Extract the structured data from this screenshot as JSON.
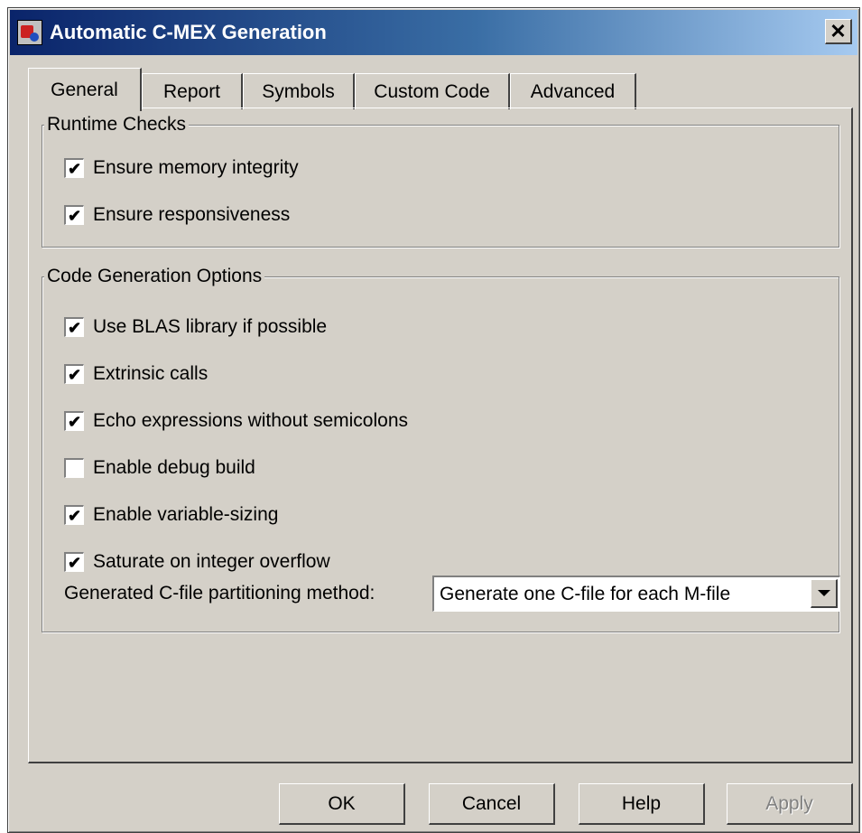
{
  "window": {
    "title": "Automatic C-MEX Generation",
    "close_label": "✕"
  },
  "tabs": [
    {
      "label": "General",
      "active": true
    },
    {
      "label": "Report",
      "active": false
    },
    {
      "label": "Symbols",
      "active": false
    },
    {
      "label": "Custom Code",
      "active": false
    },
    {
      "label": "Advanced",
      "active": false
    }
  ],
  "runtime_checks": {
    "title": "Runtime Checks",
    "options": [
      {
        "label": "Ensure memory integrity",
        "checked": true
      },
      {
        "label": "Ensure responsiveness",
        "checked": true
      }
    ]
  },
  "codegen": {
    "title": "Code Generation Options",
    "options": [
      {
        "label": "Use BLAS library if possible",
        "checked": true
      },
      {
        "label": "Extrinsic calls",
        "checked": true
      },
      {
        "label": "Echo expressions without semicolons",
        "checked": true
      },
      {
        "label": "Enable debug build",
        "checked": false
      },
      {
        "label": "Enable variable-sizing",
        "checked": true
      },
      {
        "label": "Saturate on integer overflow",
        "checked": true
      }
    ],
    "partition_label": "Generated C-file partitioning method:",
    "partition_value": "Generate one C-file for each M-file"
  },
  "buttons": {
    "ok": "OK",
    "cancel": "Cancel",
    "help": "Help",
    "apply": "Apply"
  },
  "check_mark": "✔",
  "icons": {
    "app": "matlab-app-icon",
    "close": "close-icon",
    "dropdown": "chevron-down-icon",
    "checkbox_checked": "checkmark-icon"
  }
}
